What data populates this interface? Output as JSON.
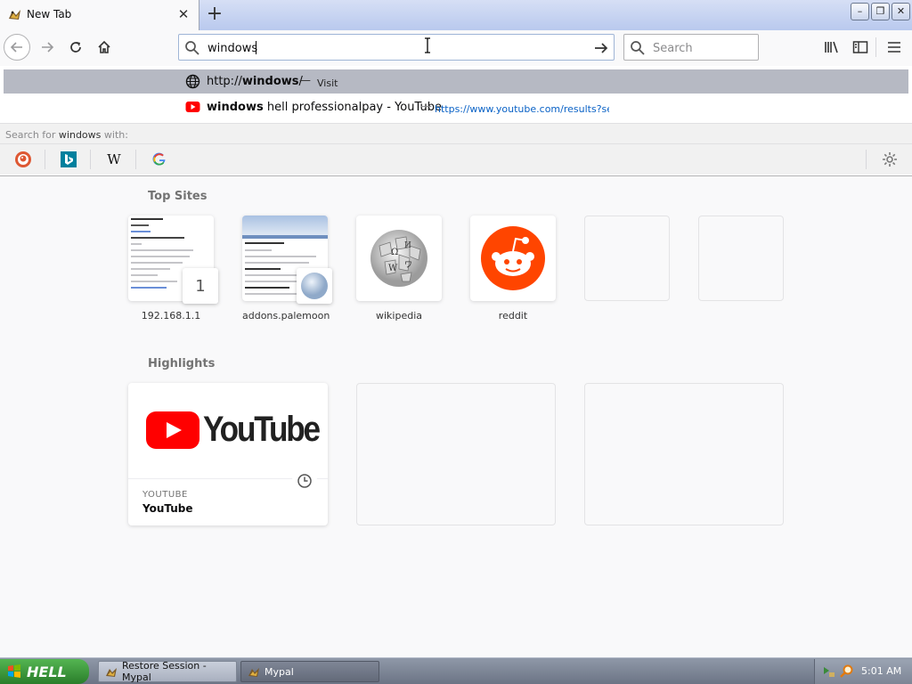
{
  "tab": {
    "title": "New Tab",
    "close_label": "✕",
    "new_tab_label": "+"
  },
  "window_controls": {
    "minimize": "–",
    "maximize": "❐",
    "close": "✕"
  },
  "nav": {
    "url_value": "windows",
    "search_placeholder": "Search"
  },
  "autocomplete": {
    "row1": {
      "url_prefix": "http://",
      "url_bold": "windows",
      "url_suffix": "/",
      "dash": "—",
      "action": "Visit"
    },
    "row2": {
      "title_bold": "windows",
      "title_rest": " hell professionalpay - YouTube",
      "dash": "—",
      "url": "https://www.youtube.com/results?searc"
    },
    "search_with": {
      "prefix": "Search for",
      "query": "windows",
      "suffix": "with:"
    }
  },
  "search_engines": [
    "duckduckgo-icon",
    "bing-icon",
    "wikipedia-icon",
    "google-icon"
  ],
  "topsites": {
    "title": "Top Sites",
    "items": [
      {
        "label": "192.168.1.1",
        "badge": "1"
      },
      {
        "label": "addons.palemoon"
      },
      {
        "label": "wikipedia"
      },
      {
        "label": "reddit"
      }
    ]
  },
  "highlights": {
    "title": "Highlights",
    "cards": [
      {
        "host": "YOUTUBE",
        "title": "YouTube",
        "logo_text": "YouTube"
      }
    ]
  },
  "taskbar": {
    "start_label": "HELL",
    "items": [
      {
        "label": "Restore Session - Mypal"
      },
      {
        "label": "Mypal"
      }
    ],
    "clock": "5:01 AM"
  },
  "colors": {
    "accent": "#0a62c6",
    "youtube_red": "#ff0000",
    "reddit_orange": "#ff4500",
    "start_green": "#3c9b3a"
  }
}
